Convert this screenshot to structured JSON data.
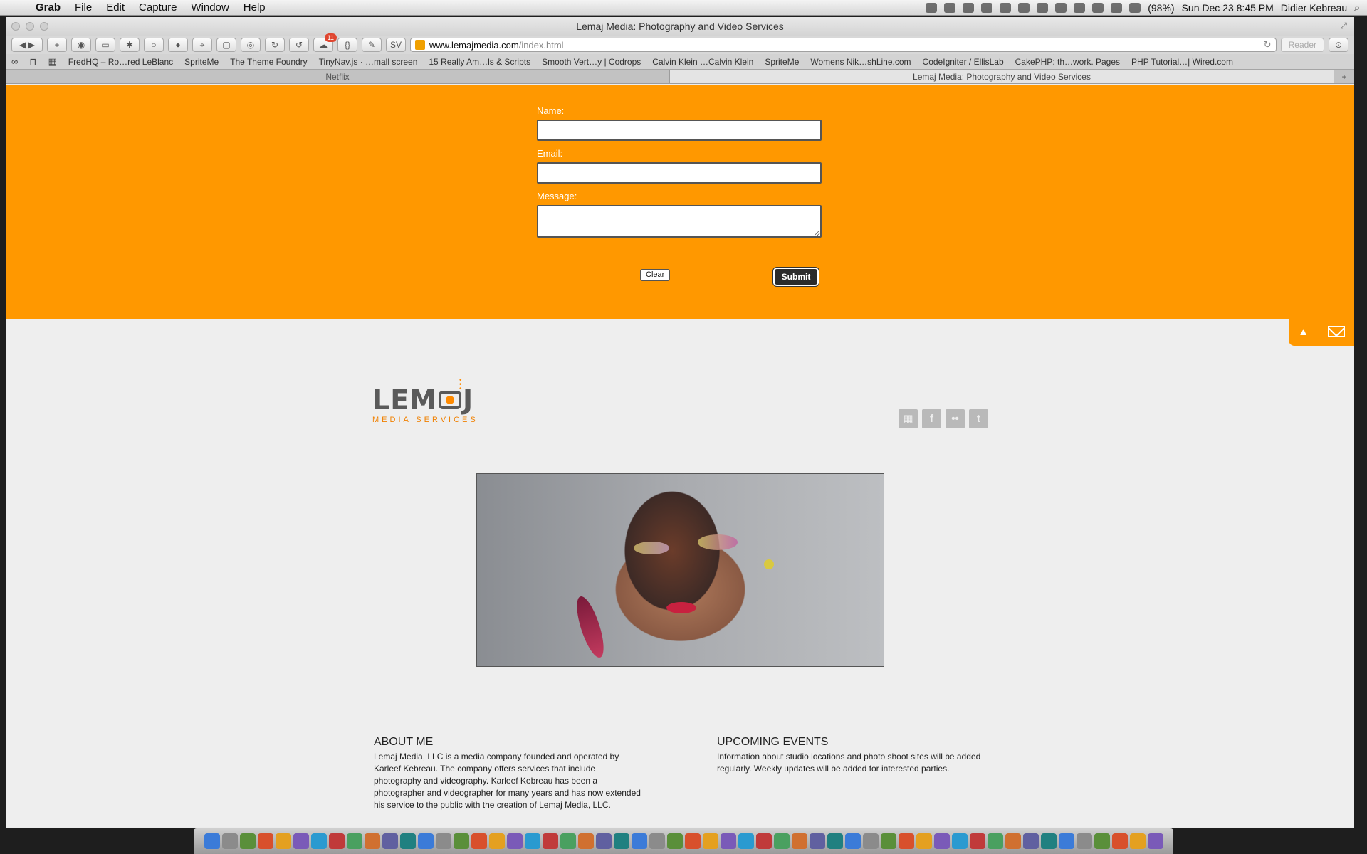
{
  "menubar": {
    "apple": "",
    "items": [
      "Grab",
      "File",
      "Edit",
      "Capture",
      "Window",
      "Help"
    ],
    "battery": "(98%)",
    "datetime": "Sun Dec 23  8:45 PM",
    "user": "Didier Kebreau",
    "search_icon": "⌕"
  },
  "window": {
    "title": "Lemaj Media: Photography and Video Services",
    "url_host": "www.lemajmedia.com",
    "url_path": "/index.html",
    "reader": "Reader",
    "toolbar_badge": "11",
    "toolbar_curly": "{}",
    "toolbar_sv": "SV"
  },
  "bookmarks": [
    "FredHQ – Ro…red LeBlanc",
    "SpriteMe",
    "The Theme Foundry",
    "TinyNav.js · …mall screen",
    "15 Really Am…ls & Scripts",
    "Smooth Vert…y | Codrops",
    "Calvin Klein …Calvin Klein",
    "SpriteMe",
    "Womens Nik…shLine.com",
    "CodeIgniter / EllisLab",
    "CakePHP: th…work. Pages",
    "PHP Tutorial…| Wired.com"
  ],
  "tabs": [
    "Netflix",
    "Lemaj Media: Photography and Video Services"
  ],
  "form": {
    "name_label": "Name:",
    "email_label": "Email:",
    "message_label": "Message:",
    "clear": "Clear",
    "submit": "Submit"
  },
  "logo": {
    "text_left": "LEM",
    "text_right": "J",
    "tagline": "MEDIA SERVICES"
  },
  "social": [
    {
      "icon": "image-icon",
      "glyph": "▦"
    },
    {
      "icon": "facebook-icon",
      "glyph": "f"
    },
    {
      "icon": "flickr-icon",
      "glyph": "••"
    },
    {
      "icon": "twitter-icon",
      "glyph": "t"
    }
  ],
  "about": {
    "title": "ABOUT ME",
    "text": "Lemaj Media, LLC is a media company founded and operated by Karleef Kebreau.  The company offers services that include photography and videography.  Karleef Kebreau has been a photographer and videographer for many years and has now extended his service to the public with the creation of Lemaj Media, LLC."
  },
  "events": {
    "title": "UPCOMING EVENTS",
    "text": "Information about studio locations and photo shoot sites will be added regularly. Weekly updates will be added for interested parties."
  },
  "colors": {
    "accent": "#ff9800",
    "page_bg": "#eeeeee"
  }
}
